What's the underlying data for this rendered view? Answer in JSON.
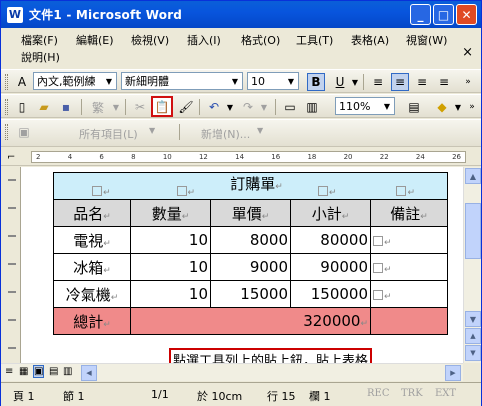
{
  "window": {
    "title": "文件1 - Microsoft Word",
    "app_icon": "W",
    "minimize": "_",
    "maximize": "□",
    "close": "✕"
  },
  "menu": {
    "items": [
      "檔案(F)",
      "編輯(E)",
      "檢視(V)",
      "插入(I)",
      "格式(O)",
      "工具(T)",
      "表格(A)",
      "視窗(W)",
      "說明(H)"
    ],
    "close_doc": "×"
  },
  "formatting": {
    "style": "內文,範例練",
    "font": "新細明體",
    "size": "10",
    "bold": "B",
    "underline": "U"
  },
  "standard": {
    "zoom": "110%"
  },
  "reviewing": {
    "show": "所有項目(L)",
    "new_comment": "新增(N)..."
  },
  "ruler": {
    "ticks": [
      "2",
      "4",
      "6",
      "8",
      "10",
      "12",
      "14",
      "16",
      "18",
      "20",
      "22",
      "24",
      "26"
    ]
  },
  "table": {
    "title": "訂購單",
    "headers": [
      "品名",
      "數量",
      "單價",
      "小計",
      "備註"
    ],
    "rows": [
      {
        "name": "電視",
        "qty": "10",
        "price": "8000",
        "subtotal": "80000"
      },
      {
        "name": "冰箱",
        "qty": "10",
        "price": "9000",
        "subtotal": "90000"
      },
      {
        "name": "冷氣機",
        "qty": "10",
        "price": "15000",
        "subtotal": "150000"
      }
    ],
    "total_label": "總計",
    "total_value": "320000"
  },
  "callout": "點選工具列上的貼上鈕，貼上表格",
  "status": {
    "page": "頁 1",
    "section": "節 1",
    "pages": "1/1",
    "at": "於 10cm",
    "line": "行 15",
    "col": "欄 1",
    "rec": "REC",
    "trk": "TRK",
    "ext": "EXT"
  },
  "colors": {
    "title_bar": "#0855dd",
    "header_row": "#cdeefa",
    "column_header": "#d9d9d9",
    "total_row": "#f08a8a",
    "callout_border": "#cc0000"
  }
}
